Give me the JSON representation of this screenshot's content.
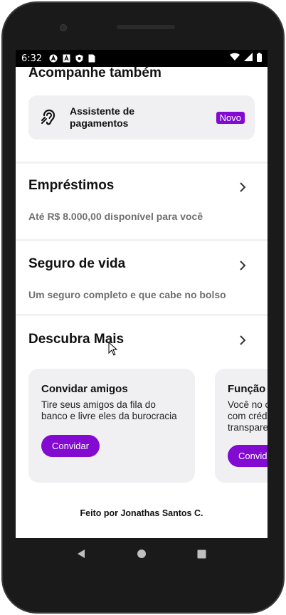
{
  "statusbar": {
    "time": "6:32",
    "icons": [
      "a-circle-icon",
      "a-box-icon",
      "shield-icon",
      "sim-card-icon"
    ],
    "right_icons": [
      "wifi-icon",
      "signal-icon",
      "battery-icon"
    ]
  },
  "also_follow": {
    "title": "Acompanhe também",
    "assistant_label": "Assistente de pagamentos",
    "badge": "Novo"
  },
  "loans": {
    "title": "Empréstimos",
    "subtitle": "Até R$ 8.000,00 disponível para você"
  },
  "life_insurance": {
    "title": "Seguro de vida",
    "subtitle": "Um seguro completo e que cabe no bolso"
  },
  "discover": {
    "title": "Descubra Mais",
    "cards": [
      {
        "title": "Convidar amigos",
        "description": "Tire seus amigos da fila do banco e livre eles da burocracia",
        "button": "Convidar"
      },
      {
        "title": "Função crédito",
        "description": "Você no controle das compras com crédito de forma fácil e transparente",
        "button": "Convidar"
      }
    ]
  },
  "footer": "Feito por Jonathas Santos C.",
  "colors": {
    "accent": "#820ad1",
    "card_bg": "#f0f0f2",
    "subtitle": "#6f6f73"
  }
}
